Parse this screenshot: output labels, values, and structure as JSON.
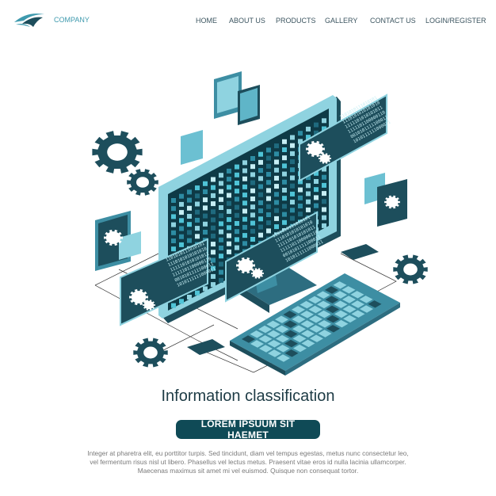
{
  "header": {
    "logo_text": "COMPANY",
    "nav": [
      {
        "label": "HOME"
      },
      {
        "label": "ABOUT US"
      },
      {
        "label": "PRODUCTS"
      },
      {
        "label": "GALLERY"
      },
      {
        "label": "CONTACT US"
      },
      {
        "label": "LOGIN/REGISTER"
      }
    ]
  },
  "hero": {
    "title": "Information classification",
    "button_label": "LOREM IPSUUM SIT HAEMET",
    "paragraph_lines": [
      "Integer at pharetra elit, eu porttitor turpis. Sed tincidunt, diam vel tempus egestas, metus nunc consectetur leo,",
      "vel fermentum risus nisl ut libero. Phasellus vel lectus metus. Praesent vitae eros id nulla lacinia ullamcorper.",
      "Maecenas maximus sit amet mi vel euismod. Quisque non consequat tortor."
    ]
  },
  "illustration": {
    "binary_text": [
      "1101010111010101",
      "1110101010101010",
      "1111101010101011",
      "1111101100000110",
      "0010101111100011",
      "1010111111000011"
    ],
    "colors": {
      "dark": "#1d4e5c",
      "mid": "#3d8ea3",
      "light": "#8fd3e0",
      "accent": "#4fc3d6"
    }
  },
  "colors": {
    "brand": "#3f9aae",
    "button": "#0f4a56",
    "title": "#1d3b45"
  }
}
